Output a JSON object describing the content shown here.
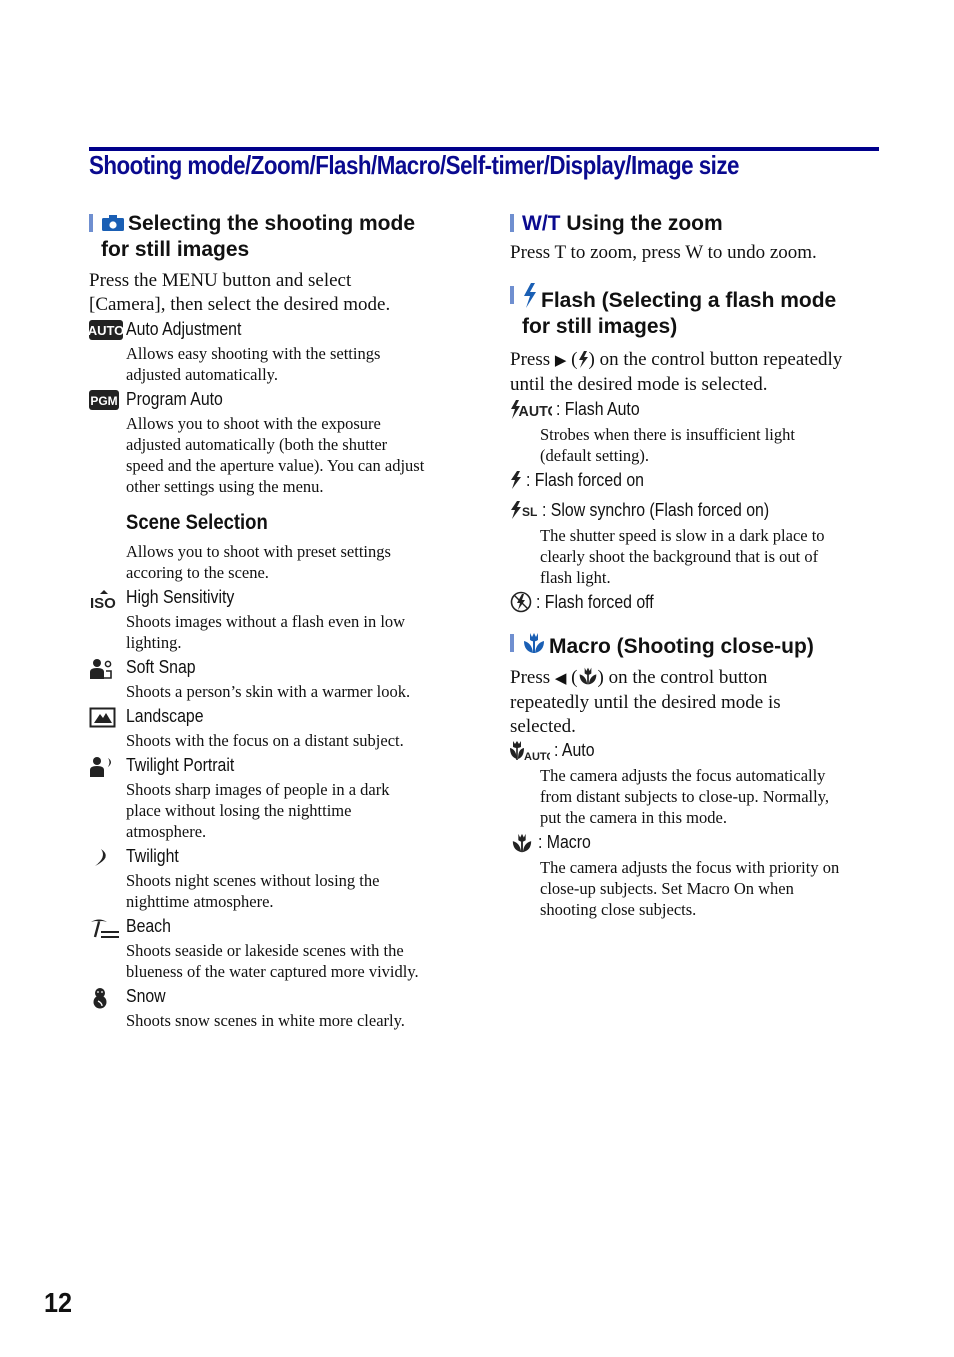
{
  "page": {
    "title": "Shooting mode/Zoom/Flash/Macro/Self-timer/Display/Image size",
    "page_number": "12",
    "accent_color": "#0a0a8f",
    "bar_color": "#6f8fd0"
  },
  "shooting_mode": {
    "icon": "camera-icon",
    "heading_line1": "Selecting the shooting mode",
    "heading_line2": "for still images",
    "intro_line1": "Press the MENU button and select",
    "intro_line2": "[Camera], then select the desired mode.",
    "modes": [
      {
        "icon": "auto-icon",
        "label": "Auto Adjustment",
        "desc": [
          "Allows easy shooting with the settings",
          "adjusted automatically."
        ]
      },
      {
        "icon": "pgm-icon",
        "label": "Program Auto",
        "desc": [
          "Allows you to shoot with the exposure",
          "adjusted automatically (both the shutter",
          "speed and the aperture value). You can adjust",
          "other settings using the menu."
        ]
      }
    ],
    "scene_selection": {
      "heading": "Scene Selection",
      "desc": [
        "Allows you to shoot with preset settings",
        "accoring to the scene."
      ],
      "scenes": [
        {
          "icon": "high-iso-icon",
          "label": "High Sensitivity",
          "desc": [
            "Shoots images without a flash even in low",
            "lighting."
          ]
        },
        {
          "icon": "soft-snap-icon",
          "label": "Soft Snap",
          "desc": [
            "Shoots a person’s skin with a warmer look."
          ]
        },
        {
          "icon": "landscape-icon",
          "label": "Landscape",
          "desc": [
            "Shoots with the focus on a distant subject."
          ]
        },
        {
          "icon": "twilight-portrait-icon",
          "label": "Twilight Portrait",
          "desc": [
            "Shoots sharp images of people in a dark",
            "place without losing the nighttime",
            "atmosphere."
          ]
        },
        {
          "icon": "twilight-icon",
          "label": "Twilight",
          "desc": [
            "Shoots night scenes without losing the",
            "nighttime atmosphere."
          ]
        },
        {
          "icon": "beach-icon",
          "label": "Beach",
          "desc": [
            "Shoots seaside or lakeside scenes with the",
            "blueness of the water captured more vividly."
          ]
        },
        {
          "icon": "snow-icon",
          "label": "Snow",
          "desc": [
            "Shoots snow scenes in white more clearly."
          ]
        }
      ]
    }
  },
  "zoom": {
    "heading_prefix": "W/T",
    "heading": "Using the zoom",
    "text": "Press T to zoom, press W to undo zoom."
  },
  "flash": {
    "icon": "flash-icon",
    "heading_line1": "Flash (Selecting a flash mode",
    "heading_line2": "for still images)",
    "intro_press": "Press",
    "intro_arrow": "▶",
    "intro_rest_line1": "on the control button repeatedly",
    "intro_line2": "until the desired mode is selected.",
    "modes": [
      {
        "icon": "flash-auto-icon",
        "label": ": Flash Auto",
        "desc": [
          "Strobes when there is insufficient light",
          "(default setting)."
        ]
      },
      {
        "icon": "flash-on-icon",
        "label": ": Flash forced on",
        "desc": []
      },
      {
        "icon": "slow-synchro-icon",
        "label": ": Slow synchro (Flash forced on)",
        "desc": [
          "The shutter speed is slow in a dark place to",
          "clearly shoot the background that is out of",
          "flash light."
        ]
      },
      {
        "icon": "flash-off-icon",
        "label": ": Flash forced off",
        "desc": []
      }
    ]
  },
  "macro": {
    "icon": "macro-icon",
    "heading": "Macro (Shooting close-up)",
    "intro_press": "Press",
    "intro_arrow": "◀",
    "intro_rest_line1": "on the control button",
    "intro_line2": "repeatedly until the desired mode is",
    "intro_line3": "selected.",
    "modes": [
      {
        "icon": "macro-auto-icon",
        "label": ": Auto",
        "desc": [
          "The camera adjusts the focus automatically",
          "from distant subjects to close-up. Normally,",
          "put the camera in this mode."
        ]
      },
      {
        "icon": "macro-on-icon",
        "label": ": Macro",
        "desc": [
          "The camera adjusts the focus with priority on",
          "close-up subjects. Set Macro On when",
          "shooting close subjects."
        ]
      }
    ]
  }
}
